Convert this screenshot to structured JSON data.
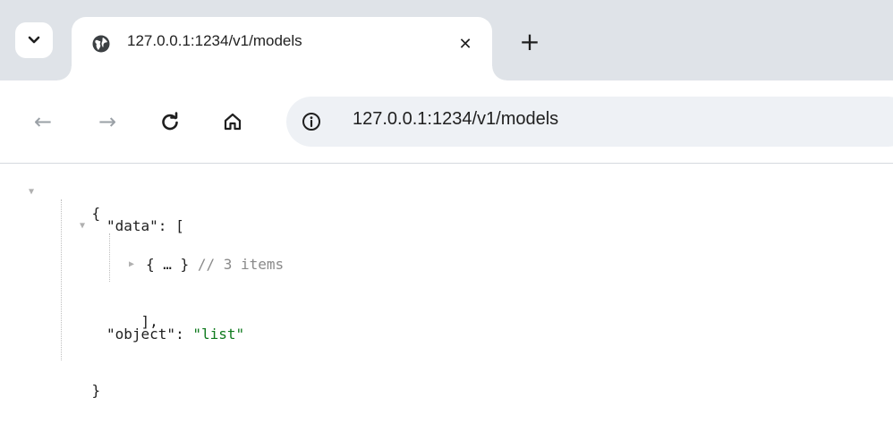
{
  "tab": {
    "title": "127.0.0.1:1234/v1/models",
    "favicon": "globe-icon",
    "close_glyph": "✕",
    "new_tab_glyph": "+"
  },
  "toolbar": {
    "back_glyph": "←",
    "forward_glyph": "→",
    "reload_glyph": "C",
    "home_icon": "home-icon",
    "info_icon": "info-icon",
    "url": "127.0.0.1:1234/v1/models"
  },
  "json_viewer": {
    "open_brace": "{",
    "data_key": "\"data\"",
    "colon": ":",
    "open_bracket": "[",
    "collapsed_item": "{ … }",
    "item_comment": "// 3 items",
    "close_bracket": "],",
    "object_key": "\"object\"",
    "object_value": "\"list\"",
    "close_brace": "}"
  },
  "colors": {
    "tabstrip_bg": "#dfe3e8",
    "omnibox_bg": "#eef1f5",
    "string_green": "#0f7a1e",
    "comment_gray": "#8a8a8a"
  }
}
